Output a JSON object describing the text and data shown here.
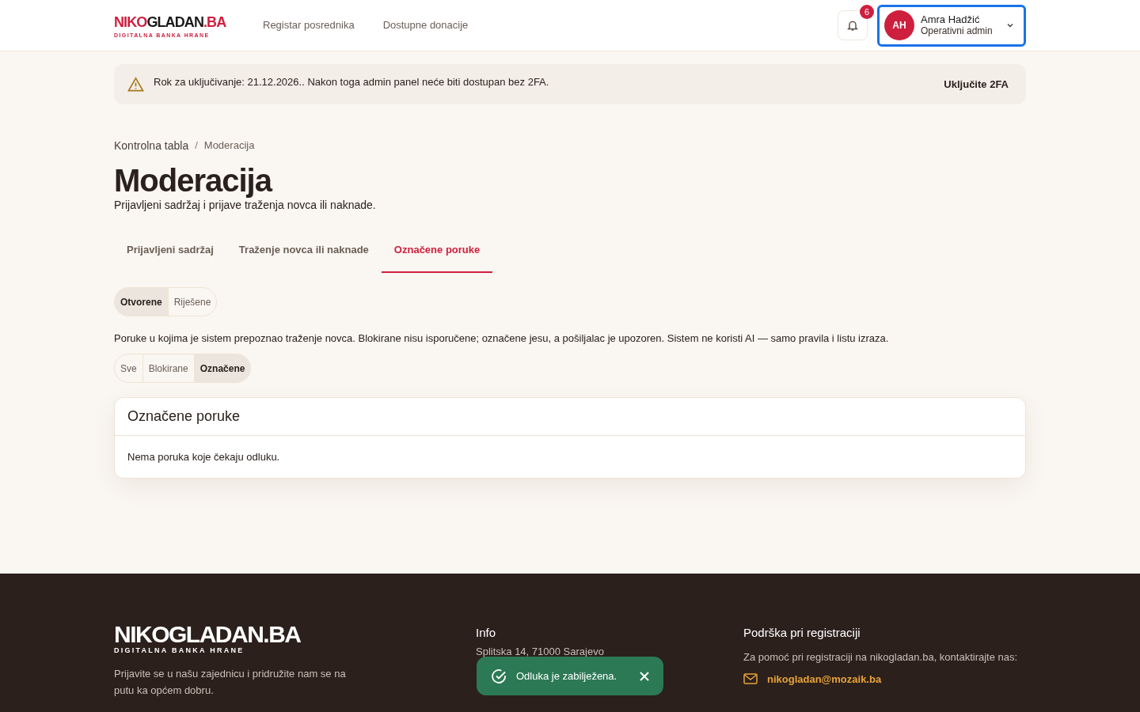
{
  "header": {
    "logo": {
      "parts": [
        {
          "text": "NIKO",
          "accent": true
        },
        {
          "text": "GLADAN",
          "accent": false
        },
        {
          "text": ".BA",
          "accent": true
        }
      ],
      "tagline": "DIGITALNA BANKA HRANE"
    },
    "nav": [
      "Registar posrednika",
      "Dostupne donacije"
    ],
    "notifications": {
      "count": "6"
    },
    "user": {
      "initials": "AH",
      "name": "Amra Hadžić",
      "role": "Operativni admin",
      "focused": true
    }
  },
  "alert": {
    "text": "Rok za uključivanje: 21.12.2026.. Nakon toga admin panel neće biti dostupan bez 2FA.",
    "action": "Uključite 2FA"
  },
  "breadcrumb": {
    "items": [
      "Kontrolna tabla",
      "Moderacija"
    ],
    "separator": "/"
  },
  "page": {
    "title": "Moderacija",
    "subtitle": "Prijavljeni sadržaj i prijave traženja novca ili naknade."
  },
  "tabs": [
    {
      "label": "Prijavljeni sadržaj",
      "selected": false
    },
    {
      "label": "Traženje novca ili naknade",
      "selected": false
    },
    {
      "label": "Označene poruke",
      "selected": true
    }
  ],
  "status_filter": [
    {
      "label": "Otvorene",
      "selected": true
    },
    {
      "label": "Riješene",
      "selected": false
    }
  ],
  "description": "Poruke u kojima je sistem prepoznao traženje novca. Blokirane nisu isporučene; označene jesu, a pošiljalac je upozoren. Sistem ne koristi AI — samo pravila i listu izraza.",
  "type_filter": [
    {
      "label": "Sve",
      "selected": false
    },
    {
      "label": "Blokirane",
      "selected": false
    },
    {
      "label": "Označene",
      "selected": true
    }
  ],
  "card": {
    "title": "Označene poruke",
    "empty_text": "Nema poruka koje čekaju odluku."
  },
  "footer": {
    "logo": "NIKOGLADAN.BA",
    "tagline": "DIGITALNA BANKA HRANE",
    "about": "Prijavite se u našu zajednicu i pridružite nam se na putu ka općem dobru.",
    "info_title": "Info",
    "address": "Splitska 14, 71000 Sarajevo",
    "support_title": "Podrška pri registraciji",
    "support_text": "Za pomoć pri registraciji na nikogladan.ba, kontaktirajte nas:",
    "email": "nikogladan@mozaik.ba"
  },
  "toast": {
    "text": "Odluka je zabilježena."
  }
}
